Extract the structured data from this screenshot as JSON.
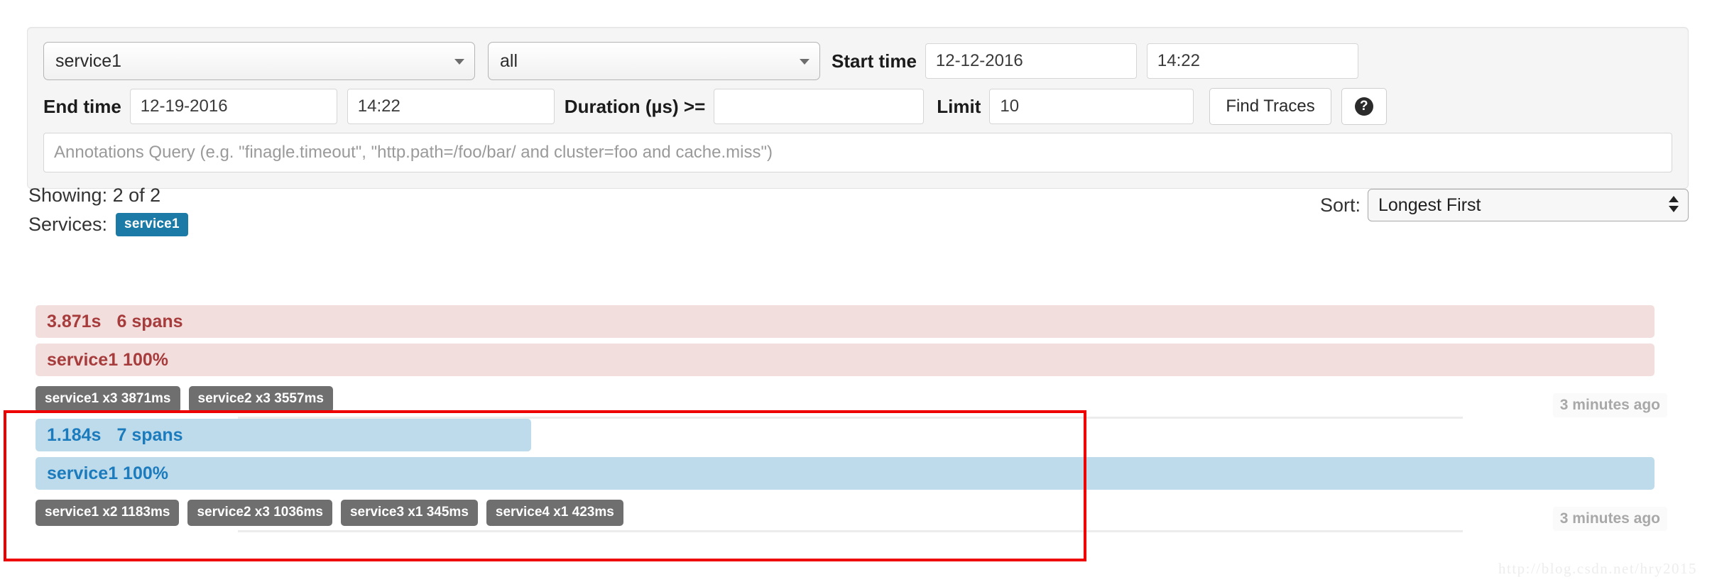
{
  "search": {
    "service_select": {
      "value": "service1",
      "caret": "chevron-down-icon"
    },
    "span_select": {
      "value": "all",
      "caret": "chevron-down-icon"
    },
    "start_time_label": "Start time",
    "start_date_value": "12-12-2016",
    "start_clock_value": "14:22",
    "end_time_label": "End time",
    "end_date_value": "12-19-2016",
    "end_clock_value": "14:22",
    "duration_label": "Duration (µs) >=",
    "duration_value": "",
    "limit_label": "Limit",
    "limit_value": "10",
    "find_traces_label": "Find Traces",
    "help_glyph": "?",
    "annotations_placeholder": "Annotations Query (e.g. \"finagle.timeout\", \"http.path=/foo/bar/ and cluster=foo and cache.miss\")",
    "annotations_value": ""
  },
  "meta": {
    "showing_text": "Showing: 2 of 2",
    "services_label": "Services:",
    "service_badge": "service1",
    "sort_label": "Sort:",
    "sort_value": "Longest First"
  },
  "results": [
    {
      "duration": "3.871s",
      "spans": "6 spans",
      "service_pct": "service1 100%",
      "timestamp": "3 minutes ago",
      "color": "red",
      "duration_bar_pct": 100,
      "service_bar_pct": 100,
      "badges": [
        "service1 x3 3871ms",
        "service2 x3 3557ms"
      ]
    },
    {
      "duration": "1.184s",
      "spans": "7 spans",
      "service_pct": "service1 100%",
      "timestamp": "3 minutes ago",
      "color": "blue",
      "duration_bar_pct": 30.6,
      "service_bar_pct": 100,
      "badges": [
        "service1 x2 1183ms",
        "service2 x3 1036ms",
        "service3 x1 345ms",
        "service4 x1 423ms"
      ]
    }
  ],
  "annotation": {
    "highlight_color": "#ee0000"
  },
  "watermark": "http://blog.csdn.net/hry2015",
  "colors": {
    "badge_blue": "#1b7ba6",
    "bar_red_bg": "#f3dede",
    "bar_red_fg": "#a63c3c",
    "bar_blue_bg": "#bedbeb",
    "bar_blue_fg": "#1b7bbd",
    "svc_badge_gray": "#6f6f6f"
  }
}
